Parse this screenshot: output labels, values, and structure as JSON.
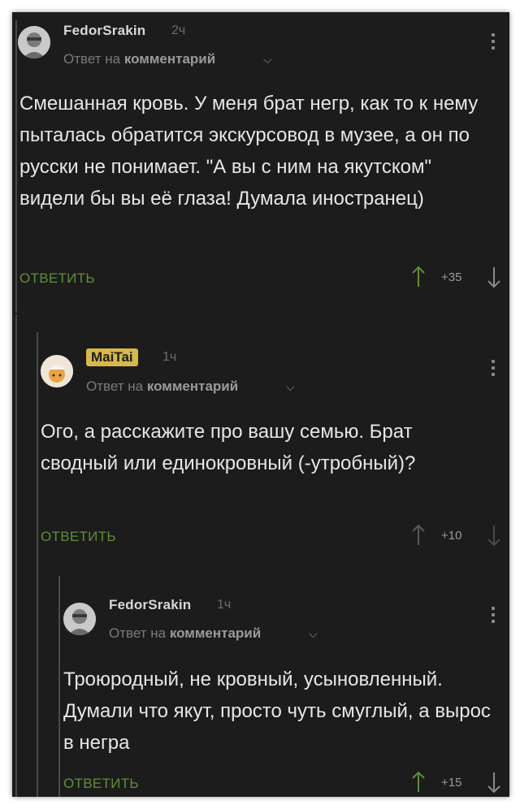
{
  "comments": [
    {
      "username": "FedorSrakin",
      "time": "2ч",
      "reply_prefix": "Ответ на",
      "reply_target": "комментарий",
      "text": "Смешанная кровь. У меня брат негр, как то к нему пыталась обратится экскурсовод в музее, а он по русски не понимает. \"А вы с ним на якутском\" видели бы вы её глаза! Думала иностранец)",
      "reply_label": "ОТВЕТИТЬ",
      "score": "+35",
      "up_color": "#5f8f3a"
    },
    {
      "username": "MaiTai",
      "time": "1ч",
      "reply_prefix": "Ответ на",
      "reply_target": "комментарий",
      "text": "Ого, а расскажите про вашу семью. Брат сводный или единокровный (-утробный)?",
      "reply_label": "ОТВЕТИТЬ",
      "score": "+10",
      "up_color": "#5a5a5a"
    },
    {
      "username": "FedorSrakin",
      "time": "1ч",
      "reply_prefix": "Ответ на",
      "reply_target": "комментарий",
      "text": "Троюродный, не кровный, усыновленный. Думали что якут, просто чуть смуглый, а вырос в негра",
      "reply_label": "ОТВЕТИТЬ",
      "score": "+15",
      "up_color": "#5f8f3a"
    }
  ],
  "colors": {
    "background": "#1c1c1c",
    "reply_button": "#5f8f3a",
    "badge": "#d8b84a"
  },
  "icons": [
    "avatar-photo",
    "chevron-down-icon",
    "more-vertical-icon",
    "arrow-up-icon",
    "arrow-down-icon"
  ]
}
